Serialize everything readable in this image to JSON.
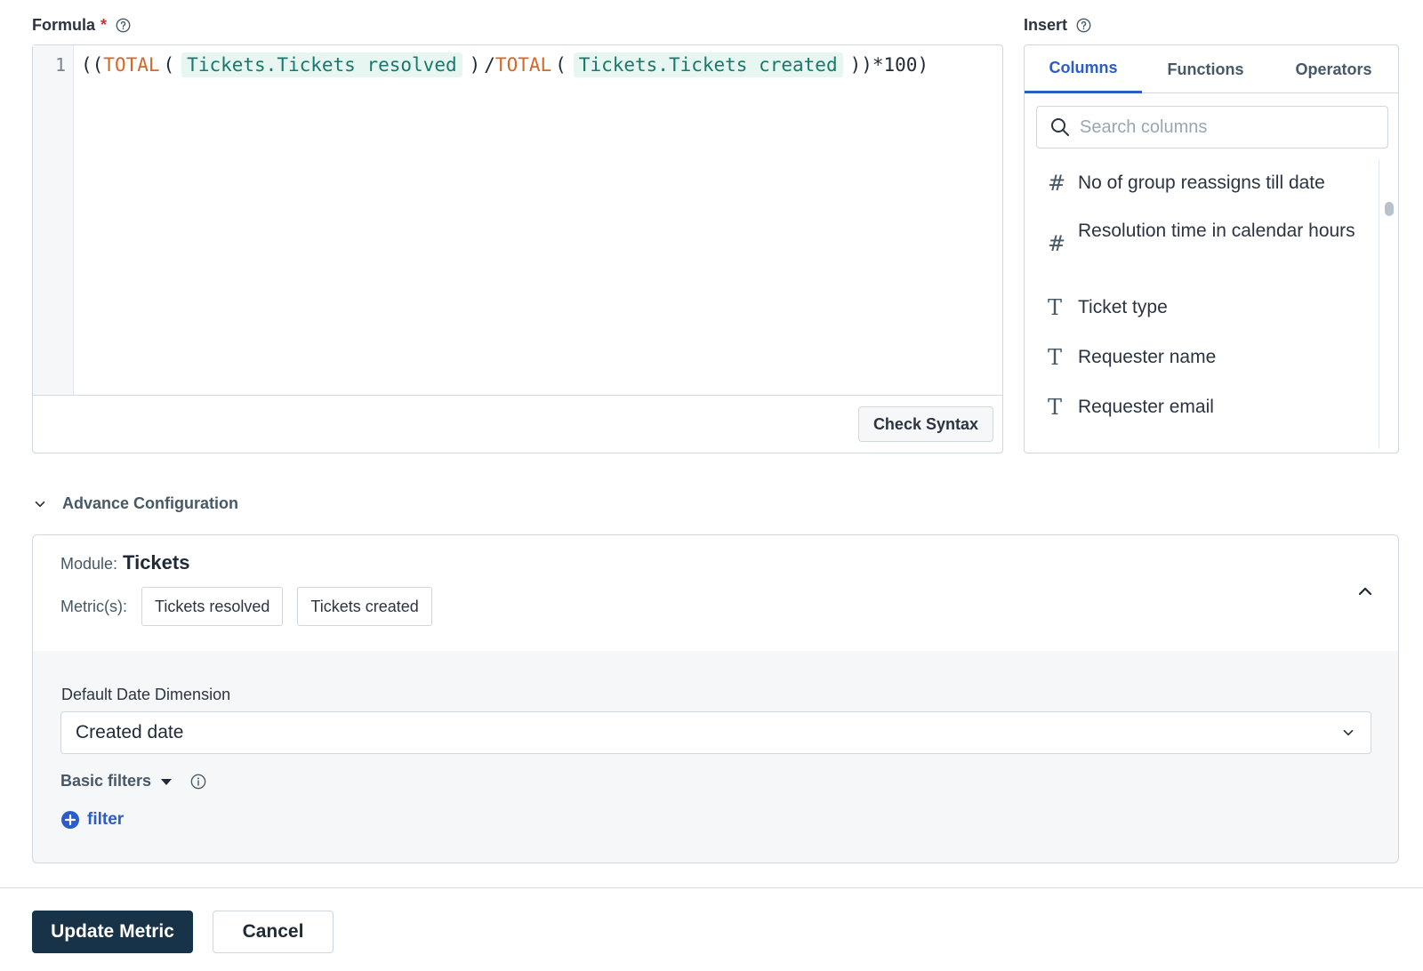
{
  "formula": {
    "label": "Formula",
    "required_mark": "*",
    "line_number": "1",
    "tokens": {
      "open": "((",
      "fn1": "TOTAL",
      "paren1_open": "(",
      "col1": "Tickets.Tickets resolved",
      "paren1_close": ")",
      "divide": "/",
      "fn2": "TOTAL",
      "paren2_open": "(",
      "col2": "Tickets.Tickets created",
      "close_tail": "))*100)"
    },
    "check_syntax_label": "Check Syntax"
  },
  "insert": {
    "label": "Insert",
    "tabs": [
      "Columns",
      "Functions",
      "Operators"
    ],
    "active_tab": "Columns",
    "search_placeholder": "Search columns",
    "columns": [
      {
        "type_icon": "#",
        "icon_name": "number-icon",
        "name": "No of group reassigns till date"
      },
      {
        "type_icon": "#",
        "icon_name": "number-icon",
        "name": "Resolution time in calendar hours"
      },
      {
        "type_icon": "T",
        "icon_name": "text-icon",
        "name": "Ticket type"
      },
      {
        "type_icon": "T",
        "icon_name": "text-icon",
        "name": "Requester name"
      },
      {
        "type_icon": "T",
        "icon_name": "text-icon",
        "name": "Requester email"
      }
    ]
  },
  "advance": {
    "title": "Advance Configuration",
    "module_label": "Module:",
    "module_value": "Tickets",
    "metrics_label": "Metric(s):",
    "metrics": [
      "Tickets resolved",
      "Tickets created"
    ],
    "date_dimension_label": "Default Date Dimension",
    "date_dimension_value": "Created date",
    "basic_filters_label": "Basic filters",
    "filter_link": "filter"
  },
  "footer": {
    "primary_label": "Update Metric",
    "cancel_label": "Cancel"
  },
  "colors": {
    "accent": "#2c5cc5",
    "primary_button": "#183247",
    "keyword": "#d4682a",
    "column_token": "#17796a",
    "required": "#d72d30"
  }
}
